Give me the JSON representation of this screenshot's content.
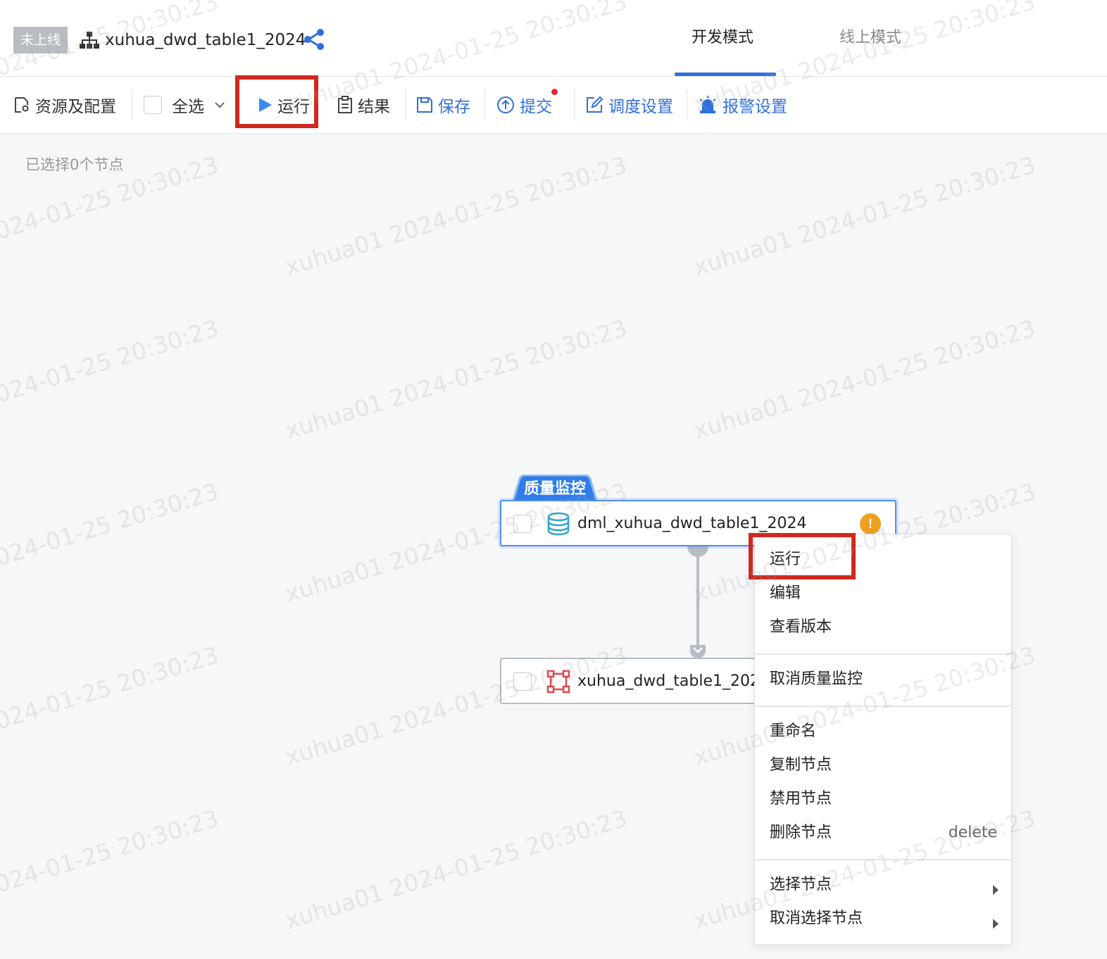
{
  "header": {
    "status_badge": "未上线",
    "title": "xuhua_dwd_table1_2024",
    "tabs": [
      {
        "label": "开发模式",
        "active": true
      },
      {
        "label": "线上模式",
        "active": false
      }
    ]
  },
  "toolbar": {
    "resources": "资源及配置",
    "select_all": "全选",
    "run": "运行",
    "result": "结果",
    "save": "保存",
    "submit": "提交",
    "schedule": "调度设置",
    "alarm": "报警设置"
  },
  "canvas": {
    "selected_count_text": "已选择0个节点",
    "watermark": "xuhua01 2024-01-25 20:30:23",
    "tag_label": "质量监控",
    "nodes": [
      {
        "label": "dml_xuhua_dwd_table1_2024",
        "icon": "database-icon",
        "warning": "!"
      },
      {
        "label": "xuhua_dwd_table1_2024",
        "icon": "table-node-icon"
      }
    ]
  },
  "context_menu": {
    "groups": [
      [
        "运行",
        "编辑",
        "查看版本"
      ],
      [
        "取消质量监控"
      ],
      [
        "重命名",
        "复制节点",
        "禁用节点",
        "删除节点"
      ],
      [
        "选择节点",
        "取消选择节点"
      ]
    ],
    "delete_shortcut": "delete"
  },
  "colors": {
    "accent": "#2f6fe0",
    "highlight": "#d0281e",
    "badge_bg": "#b9bcc2",
    "warning": "#f0a020"
  }
}
